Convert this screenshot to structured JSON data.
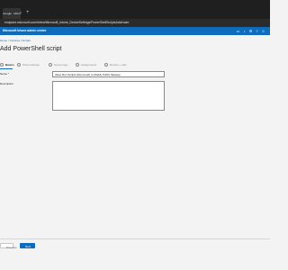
{
  "browser": {
    "tab_title": "Google · Micro",
    "tab_close": "×",
    "new_tab": "+",
    "url": "endpoint.microsoft.com/#view/Microsoft_Intune_DeviceSettings/PowerShellScriptsAdd/roam"
  },
  "portal": {
    "title": "Microsoft Intune admin center",
    "header_icons": [
      "screen-icon",
      "bell-icon",
      "gear-icon",
      "help-icon",
      "feedback-icon",
      "avatar-icon"
    ]
  },
  "breadcrumb": "Home > Devices | Scripts",
  "page_title": "Add PowerShell script",
  "more_label": "...",
  "steps": [
    {
      "label": "Basics",
      "state": "active"
    },
    {
      "label": "Script settings",
      "state": "pending"
    },
    {
      "label": "Scope tags",
      "state": "pending"
    },
    {
      "label": "Assignments",
      "state": "pending"
    },
    {
      "label": "Review + add",
      "state": "pending"
    }
  ],
  "form": {
    "name_label": "Name *",
    "name_value": "Allow Run Scripts (Removed) to Modify Public Skeleup",
    "description_label": "Description",
    "description_value": ""
  },
  "footer": {
    "previous_label": "Previous",
    "next_label": "Next"
  }
}
